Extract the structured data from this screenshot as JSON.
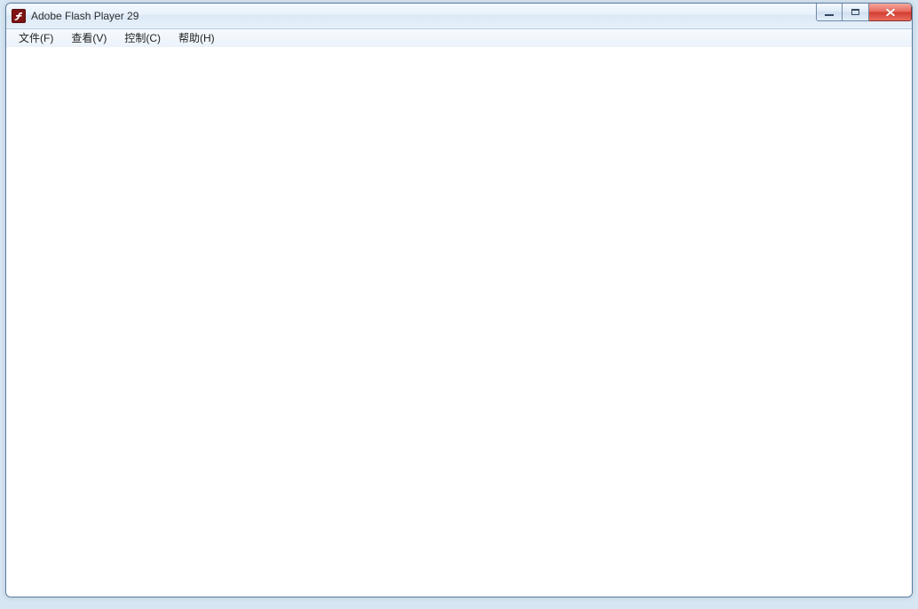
{
  "window": {
    "title": "Adobe Flash Player 29"
  },
  "menu": {
    "items": [
      {
        "label": "文件(F)"
      },
      {
        "label": "查看(V)"
      },
      {
        "label": "控制(C)"
      },
      {
        "label": "帮助(H)"
      }
    ]
  }
}
